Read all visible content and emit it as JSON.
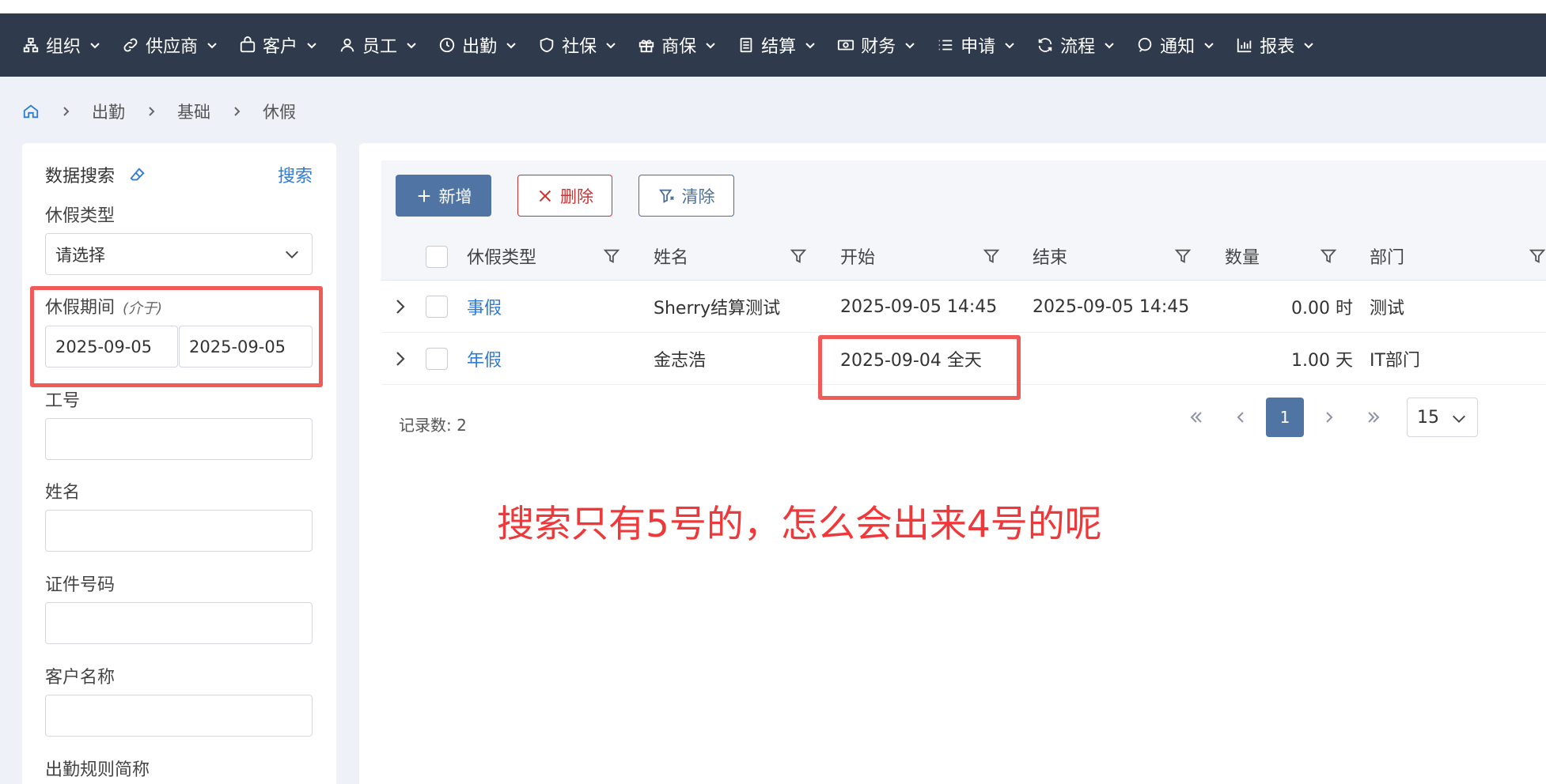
{
  "nav": {
    "items": [
      {
        "label": "组织",
        "icon": "org-icon"
      },
      {
        "label": "供应商",
        "icon": "link-icon"
      },
      {
        "label": "客户",
        "icon": "bag-icon"
      },
      {
        "label": "员工",
        "icon": "user-icon"
      },
      {
        "label": "出勤",
        "icon": "clock-icon"
      },
      {
        "label": "社保",
        "icon": "shield-icon"
      },
      {
        "label": "商保",
        "icon": "gift-icon"
      },
      {
        "label": "结算",
        "icon": "receipt-icon"
      },
      {
        "label": "财务",
        "icon": "money-icon"
      },
      {
        "label": "申请",
        "icon": "list-icon"
      },
      {
        "label": "流程",
        "icon": "refresh-icon"
      },
      {
        "label": "通知",
        "icon": "chat-icon"
      },
      {
        "label": "报表",
        "icon": "bar-chart-icon"
      }
    ]
  },
  "breadcrumb": {
    "items": [
      "出勤",
      "基础",
      "休假"
    ]
  },
  "sidebar": {
    "title": "数据搜索",
    "search_label": "搜索",
    "leave_type_label": "休假类型",
    "leave_type_value": "请选择",
    "period_label": "休假期间",
    "period_hint": "(介于)",
    "period_start": "2025-09-05",
    "period_end": "2025-09-05",
    "emp_no_label": "工号",
    "name_label": "姓名",
    "id_no_label": "证件号码",
    "customer_label": "客户名称",
    "rule_label": "出勤规则简称"
  },
  "toolbar": {
    "add_label": "新增",
    "delete_label": "删除",
    "clear_label": "清除"
  },
  "table": {
    "headers": {
      "type": "休假类型",
      "name": "姓名",
      "start": "开始",
      "end": "结束",
      "qty": "数量",
      "dept": "部门"
    },
    "rows": [
      {
        "type": "事假",
        "name": "Sherry结算测试",
        "start": "2025-09-05 14:45",
        "end": "2025-09-05 14:45",
        "qty": "0.00 时",
        "dept": "测试"
      },
      {
        "type": "年假",
        "name": "金志浩",
        "start": "2025-09-04 全天",
        "end": "",
        "qty": "1.00 天",
        "dept": "IT部门"
      }
    ]
  },
  "footer": {
    "record_count_label": "记录数: 2",
    "current_page": "1",
    "page_size": "15"
  },
  "annotation": "搜索只有5号的，怎么会出来4号的呢",
  "colors": {
    "nav_bg": "#2f3a4c",
    "primary": "#5075a4",
    "link": "#2f7bd4",
    "danger": "#d32f2f",
    "annotation": "#f0383a"
  }
}
